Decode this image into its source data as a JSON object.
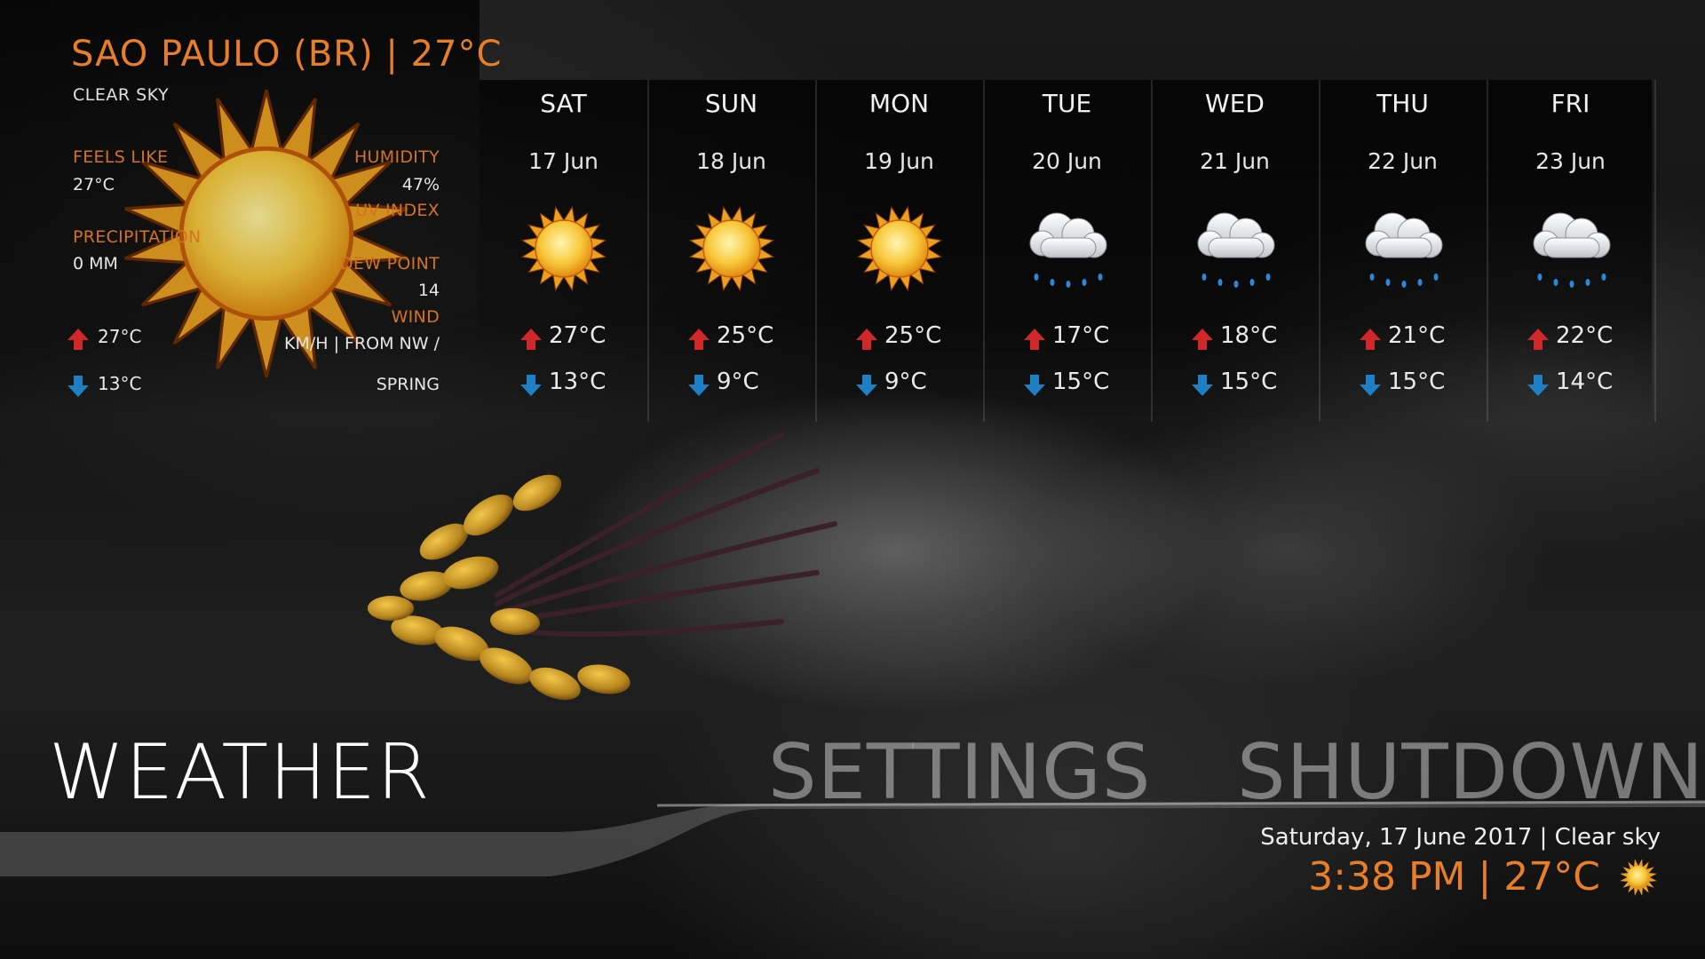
{
  "current": {
    "city_line": "SAO PAULO (BR) | 27°C",
    "condition": "CLEAR SKY",
    "feels_like_label": "FEELS LIKE",
    "feels_like_value": "27°C",
    "precip_label": "PRECIPITATION",
    "precip_value": "0 MM",
    "humidity_label": "HUMIDITY",
    "humidity_value": "47%",
    "uv_label": "UV INDEX",
    "dew_label": "DEW POINT",
    "dew_value": "14",
    "wind_label": "WIND",
    "wind_value": "KM/H | FROM NW /",
    "season": "SPRING",
    "high": "27°C",
    "low": "13°C",
    "icon": "sun-icon"
  },
  "forecast": [
    {
      "day": "SAT",
      "date": "17 Jun",
      "icon": "sun-icon",
      "high": "27°C",
      "low": "13°C"
    },
    {
      "day": "SUN",
      "date": "18 Jun",
      "icon": "sun-icon",
      "high": "25°C",
      "low": "9°C"
    },
    {
      "day": "MON",
      "date": "19 Jun",
      "icon": "sun-icon",
      "high": "25°C",
      "low": "9°C"
    },
    {
      "day": "TUE",
      "date": "20 Jun",
      "icon": "rain-cloud-icon",
      "high": "17°C",
      "low": "15°C"
    },
    {
      "day": "WED",
      "date": "21 Jun",
      "icon": "rain-cloud-icon",
      "high": "18°C",
      "low": "15°C"
    },
    {
      "day": "THU",
      "date": "22 Jun",
      "icon": "rain-cloud-icon",
      "high": "21°C",
      "low": "15°C"
    },
    {
      "day": "FRI",
      "date": "23 Jun",
      "icon": "rain-cloud-icon",
      "high": "22°C",
      "low": "14°C"
    }
  ],
  "menu": {
    "weather": "WEATHER",
    "settings": "SETTINGS",
    "shutdown": "SHUTDOWN"
  },
  "clock": {
    "date_line": "Saturday, 17 June 2017 | Clear sky",
    "time_line": "3:38 PM | 27°C",
    "icon": "sun-icon"
  },
  "colors": {
    "accent": "#e77f2a",
    "up_arrow": "#d0282a",
    "down_arrow": "#1f7fc4"
  }
}
